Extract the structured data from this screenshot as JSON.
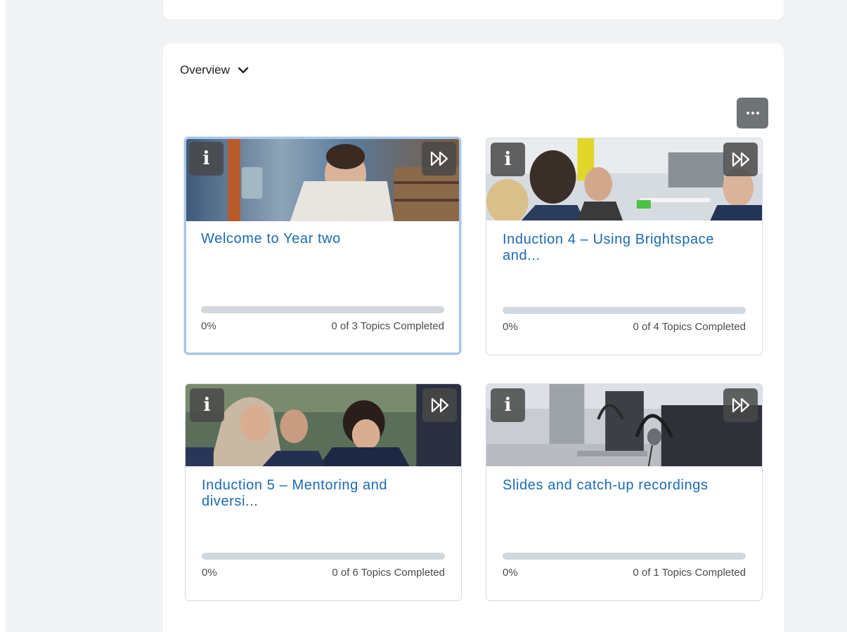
{
  "overview": {
    "title": "Overview"
  },
  "toolbar": {
    "more_label": "…"
  },
  "cards": [
    {
      "title": "Welcome to Year two",
      "percent": "0%",
      "progress": 0,
      "topics": "0 of 3 Topics Completed"
    },
    {
      "title": "Induction 4 – Using Brightspace and...",
      "percent": "0%",
      "progress": 0,
      "topics": "0 of 4 Topics Completed"
    },
    {
      "title": "Induction 5 – Mentoring and diversi...",
      "percent": "0%",
      "progress": 0,
      "topics": "0 of 6 Topics Completed"
    },
    {
      "title": "Slides and catch-up recordings",
      "percent": "0%",
      "progress": 0,
      "topics": "0 of 1 Topics Completed"
    }
  ],
  "icons": {
    "info": "info-icon",
    "fast_forward": "fast-forward-icon",
    "chevron": "chevron-down-icon",
    "more": "more-options-icon"
  },
  "colors": {
    "link": "#1a6ab3",
    "progress_track": "#d1d7df",
    "button_bg": "#6e7376",
    "focus_border": "#a9c6e8"
  }
}
